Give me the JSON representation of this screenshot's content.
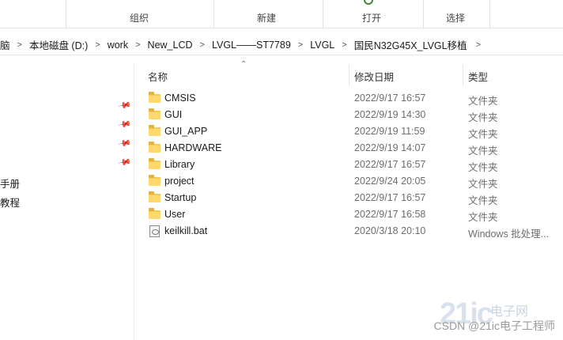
{
  "ribbon": {
    "groups": [
      "组织",
      "新建",
      "打开",
      "选择"
    ]
  },
  "address": {
    "crumbs": [
      "脑",
      "本地磁盘 (D:)",
      "work",
      "New_LCD",
      "LVGL——ST7789",
      "LVGL",
      "国民N32G45X_LVGL移植"
    ],
    "separator": ">",
    "dropdown": "⌄"
  },
  "nav": {
    "pin_icon": "pin-icon",
    "items": [
      "手册",
      "教程"
    ]
  },
  "columns": {
    "name": "名称",
    "modified": "修改日期",
    "type": "类型"
  },
  "files": [
    {
      "name": "CMSIS",
      "modified": "2022/9/17 16:57",
      "type": "文件夹",
      "icon": "folder-icon"
    },
    {
      "name": "GUI",
      "modified": "2022/9/19 14:30",
      "type": "文件夹",
      "icon": "folder-icon"
    },
    {
      "name": "GUI_APP",
      "modified": "2022/9/19 11:59",
      "type": "文件夹",
      "icon": "folder-icon"
    },
    {
      "name": "HARDWARE",
      "modified": "2022/9/19 14:07",
      "type": "文件夹",
      "icon": "folder-icon"
    },
    {
      "name": "Library",
      "modified": "2022/9/17 16:57",
      "type": "文件夹",
      "icon": "folder-icon"
    },
    {
      "name": "project",
      "modified": "2022/9/24 20:05",
      "type": "文件夹",
      "icon": "folder-icon"
    },
    {
      "name": "Startup",
      "modified": "2022/9/17 16:57",
      "type": "文件夹",
      "icon": "folder-icon"
    },
    {
      "name": "User",
      "modified": "2022/9/17 16:58",
      "type": "文件夹",
      "icon": "folder-icon"
    },
    {
      "name": "keilkill.bat",
      "modified": "2020/3/18 20:10",
      "type": "Windows 批处理...",
      "icon": "batch-file-icon"
    }
  ],
  "watermark": {
    "text": "CSDN @21ic电子工程师",
    "brand": "21ic",
    "brand_sub": "电子网"
  }
}
